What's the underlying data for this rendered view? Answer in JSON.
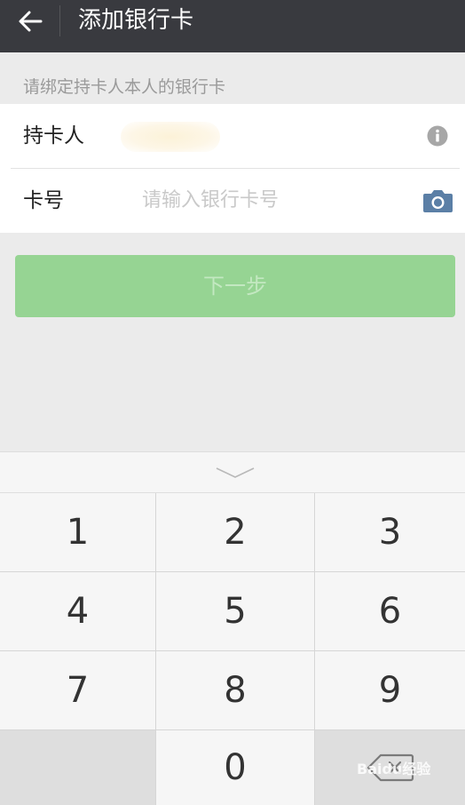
{
  "header": {
    "title": "添加银行卡"
  },
  "hint": "请绑定持卡人本人的银行卡",
  "form": {
    "holder_label": "持卡人",
    "cardno_label": "卡号",
    "cardno_placeholder": "请输入银行卡号"
  },
  "next_label": "下一步",
  "keypad": {
    "keys": [
      "1",
      "2",
      "3",
      "4",
      "5",
      "6",
      "7",
      "8",
      "9",
      "",
      "0",
      "delete"
    ]
  },
  "watermark": "Baidu经验",
  "colors": {
    "topbar": "#393a3f",
    "accent": "#96d493",
    "icon_blue": "#5b7fa6"
  },
  "icons": [
    "back-arrow-icon",
    "info-icon",
    "camera-icon",
    "chevron-down-icon",
    "backspace-icon"
  ]
}
